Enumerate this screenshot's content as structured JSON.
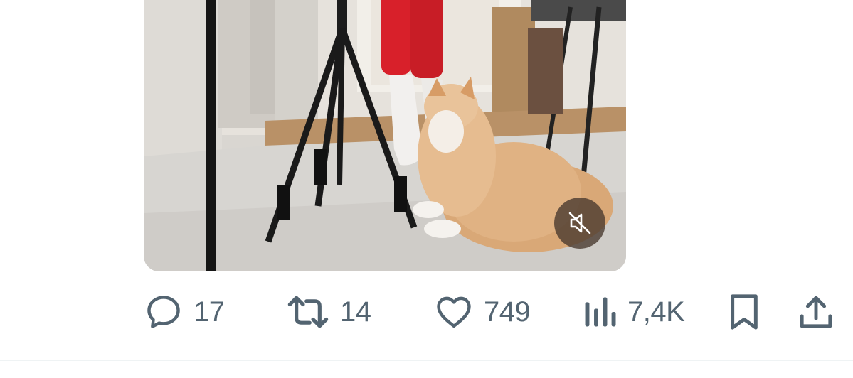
{
  "media": {
    "mute_icon": "speaker-muted-icon"
  },
  "actions": {
    "reply": {
      "icon": "reply-bubble-icon",
      "count": "17"
    },
    "repost": {
      "icon": "repost-arrows-icon",
      "count": "14"
    },
    "like": {
      "icon": "heart-icon",
      "count": "749"
    },
    "views": {
      "icon": "views-bar-chart-icon",
      "count": "7,4K"
    },
    "bookmark": {
      "icon": "bookmark-icon"
    },
    "share": {
      "icon": "share-upload-icon"
    }
  },
  "colors": {
    "action_gray": "#536471",
    "divider": "#eff3f4"
  }
}
